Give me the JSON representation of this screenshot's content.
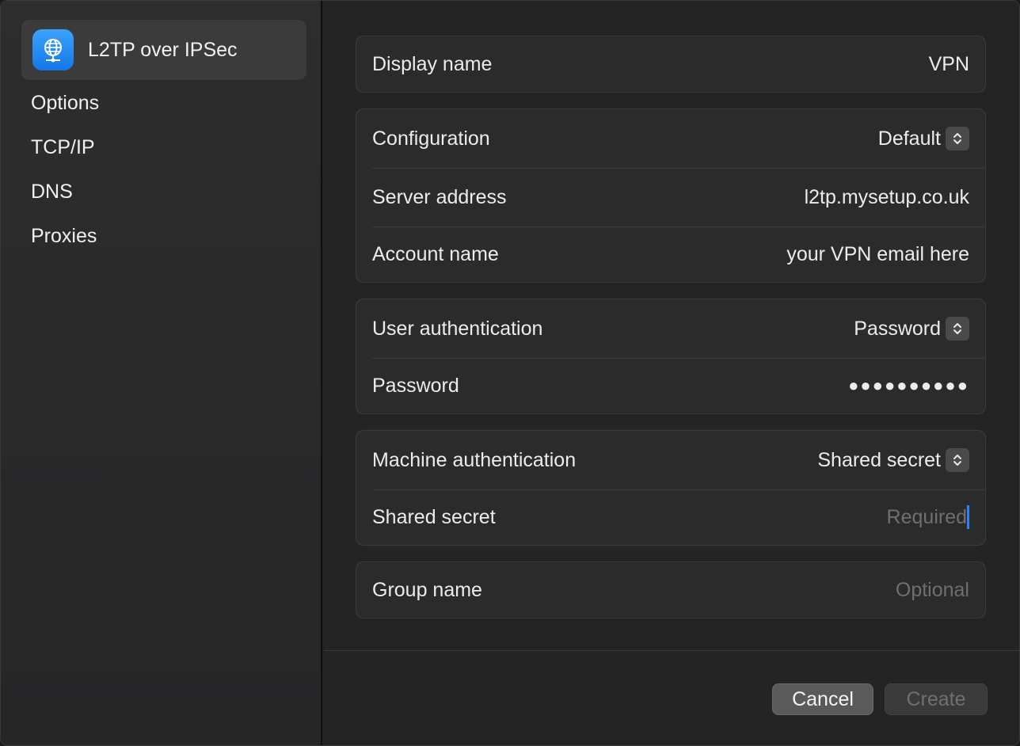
{
  "sidebar": {
    "selected": {
      "label": "L2TP over IPSec",
      "icon": "vpn-globe-icon",
      "accent": "#1a7ff0"
    },
    "items": [
      {
        "label": "Options"
      },
      {
        "label": "TCP/IP"
      },
      {
        "label": "DNS"
      },
      {
        "label": "Proxies"
      }
    ]
  },
  "form": {
    "display_name": {
      "label": "Display name",
      "value": "VPN"
    },
    "configuration": {
      "label": "Configuration",
      "value": "Default"
    },
    "server_address": {
      "label": "Server address",
      "value": "l2tp.mysetup.co.uk"
    },
    "account_name": {
      "label": "Account name",
      "value": "your VPN email here"
    },
    "user_auth": {
      "label": "User authentication",
      "value": "Password"
    },
    "password": {
      "label": "Password",
      "value": "●●●●●●●●●●"
    },
    "machine_auth": {
      "label": "Machine authentication",
      "value": "Shared secret"
    },
    "shared_secret": {
      "label": "Shared secret",
      "placeholder": "Required"
    },
    "group_name": {
      "label": "Group name",
      "placeholder": "Optional"
    }
  },
  "buttons": {
    "cancel": "Cancel",
    "create": "Create"
  },
  "colors": {
    "caret": "#2f7fff",
    "background": "#242424"
  }
}
